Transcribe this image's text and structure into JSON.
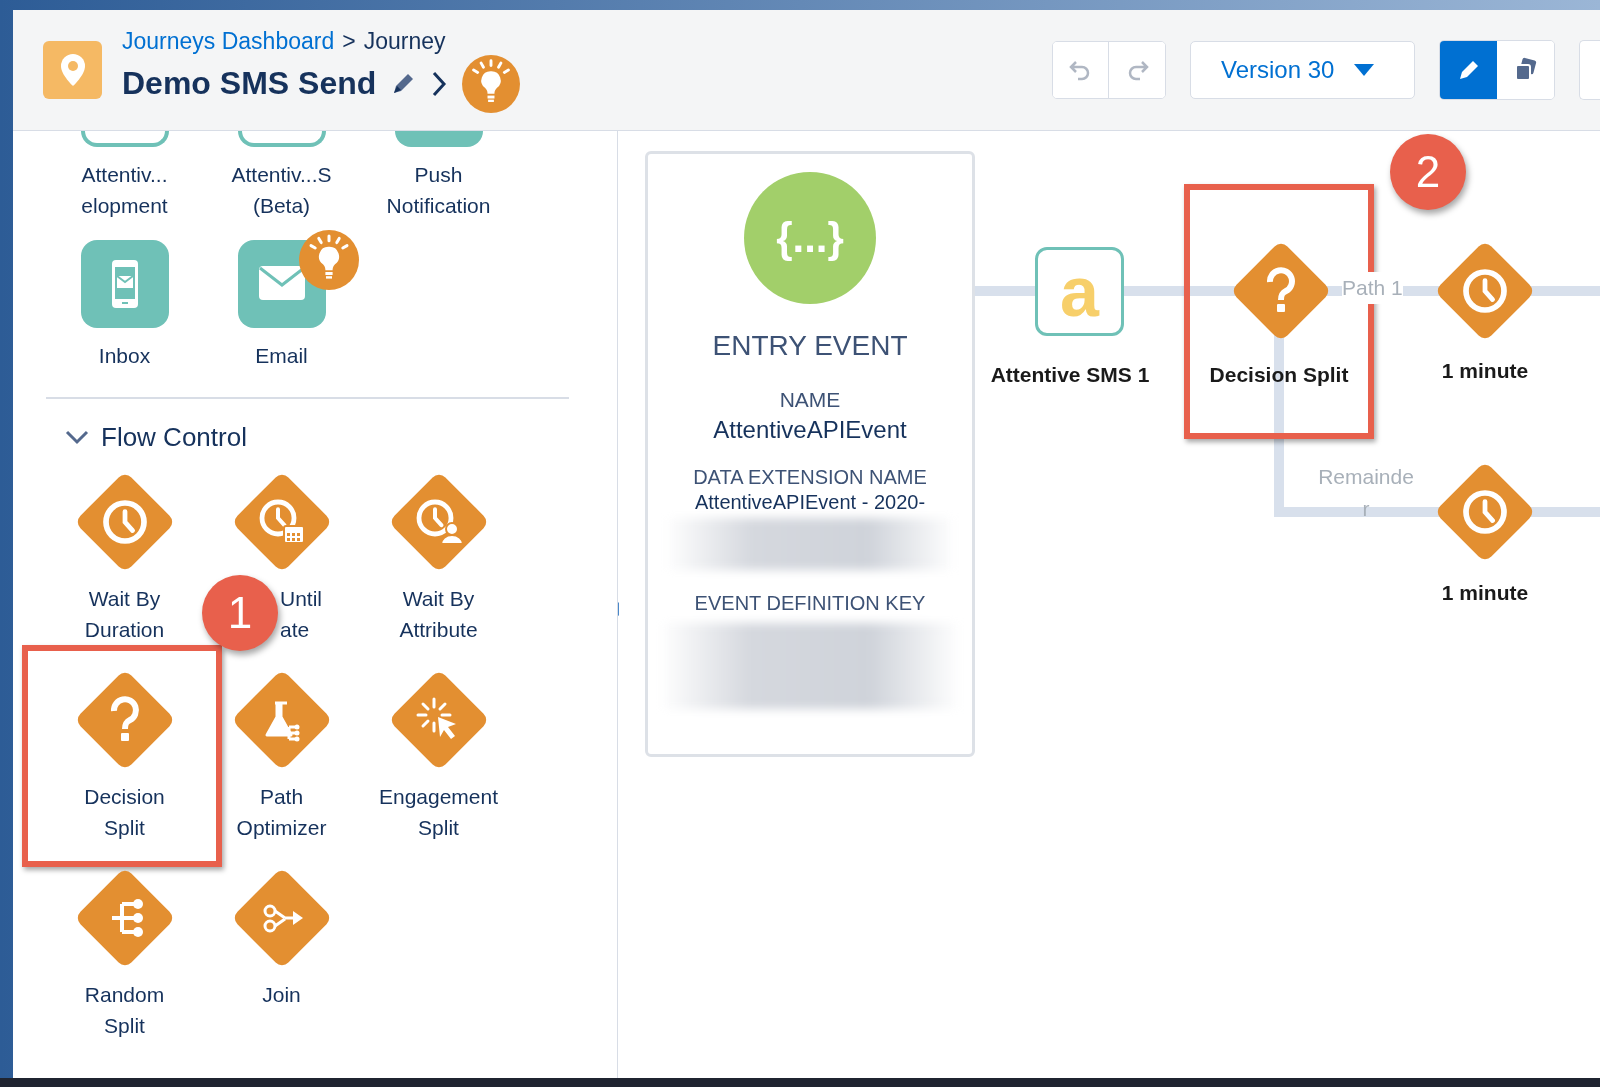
{
  "header": {
    "breadcrumb": [
      {
        "kind": "link",
        "text": "Journeys Dashboard"
      },
      {
        "kind": "separator",
        "text": ">"
      },
      {
        "kind": "current",
        "text": "Journey"
      }
    ],
    "title": "Demo SMS Send",
    "tip": true,
    "history": [
      {
        "kind": "undo",
        "disabled": true
      },
      {
        "kind": "redo",
        "disabled": true
      }
    ],
    "version": "Version 30",
    "modes": [
      {
        "kind": "edit",
        "selected": true
      },
      {
        "kind": "copy",
        "selected": false
      }
    ]
  },
  "palette": {
    "top_items": [
      {
        "kind": "outline",
        "lines": [
          "Attentiv...",
          "elopment"
        ],
        "tip": false
      },
      {
        "kind": "outline",
        "lines": [
          "Attentiv...S",
          "(Beta)"
        ],
        "tip": false
      },
      {
        "kind": "filled",
        "lines": [
          "Push",
          "Notification"
        ],
        "tip": false
      },
      {
        "kind": "phone",
        "lines": [
          "Inbox"
        ],
        "tip": false
      },
      {
        "kind": "envelope",
        "lines": [
          "Email"
        ],
        "tip": true
      }
    ],
    "sections": [
      {
        "title": "Flow Control",
        "expanded": true,
        "items": [
          {
            "kind": "clock",
            "lines": [
              "Wait By",
              "Duration"
            ],
            "highlighted": false
          },
          {
            "kind": "clock-calendar",
            "lines": [
              "Until",
              "ate"
            ],
            "highlighted": false
          },
          {
            "kind": "clock-person",
            "lines": [
              "Wait By",
              "Attribute"
            ],
            "highlighted": false
          },
          {
            "kind": "question",
            "lines": [
              "Decision",
              "Split"
            ],
            "highlighted": true
          },
          {
            "kind": "flask",
            "lines": [
              "Path",
              "Optimizer"
            ],
            "highlighted": false
          },
          {
            "kind": "cursor",
            "lines": [
              "Engagement",
              "Split"
            ],
            "highlighted": false
          },
          {
            "kind": "branches",
            "lines": [
              "Random",
              "Split"
            ],
            "highlighted": false
          },
          {
            "kind": "join",
            "lines": [
              "Join"
            ],
            "highlighted": false
          }
        ]
      }
    ]
  },
  "canvas": {
    "entry": {
      "icon_text": "{...}",
      "title": "ENTRY EVENT",
      "fields": [
        {
          "label": "NAME",
          "value": "AttentiveAPIEvent",
          "redacted": false
        },
        {
          "label": "DATA EXTENSION NAME",
          "value": "AttentiveAPIEvent - 2020-",
          "redacted": true
        },
        {
          "label": "EVENT DEFINITION KEY",
          "redacted": true
        }
      ]
    },
    "nodes": [
      {
        "kind": "sms",
        "icon_text": "a",
        "label": "Attentive SMS 1",
        "highlighted": false
      },
      {
        "kind": "decision",
        "label": "Decision Split",
        "highlighted": true
      },
      {
        "kind": "wait",
        "label": "1 minute",
        "highlighted": false
      },
      {
        "kind": "wait",
        "label": "1 minute",
        "highlighted": false
      }
    ],
    "paths": [
      "Path 1",
      "Remainder"
    ]
  },
  "callouts": [
    "1",
    "2"
  ]
}
